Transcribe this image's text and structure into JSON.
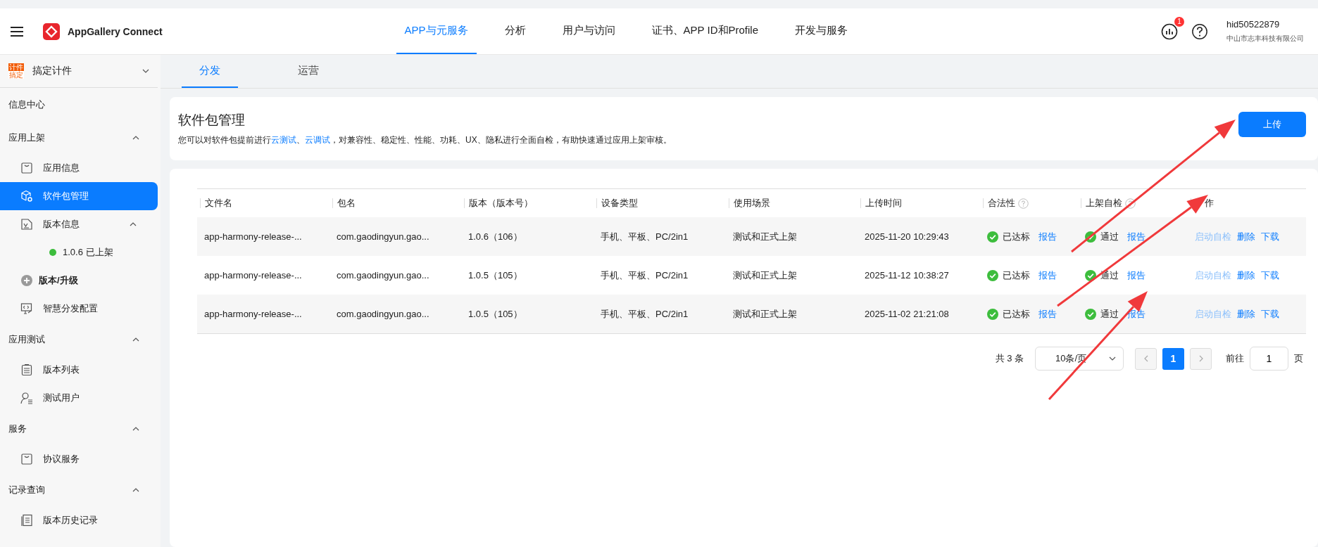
{
  "top_bar": {
    "logo_text": "AppGallery Connect",
    "nav": [
      {
        "label": "APP与元服务",
        "selected": true
      },
      {
        "label": "分析",
        "selected": false
      },
      {
        "label": "用户与访问",
        "selected": false
      },
      {
        "label": "证书、APP ID和Profile",
        "selected": false
      },
      {
        "label": "开发与服务",
        "selected": false
      }
    ],
    "notification_badge": "1",
    "user": {
      "name": "hid50522879",
      "company": "中山市志丰科技有限公司"
    }
  },
  "sidebar": {
    "app": {
      "name": "搞定计件",
      "logo_lines": [
        "计件",
        "搞定"
      ]
    },
    "groups": [
      {
        "label": "信息中心",
        "kind": "link"
      },
      {
        "label": "应用上架",
        "kind": "section",
        "expanded": true,
        "items": [
          {
            "label": "应用信息",
            "kind": "box",
            "selected": false
          },
          {
            "label": "软件包管理",
            "kind": "package",
            "selected": true
          },
          {
            "label": "版本信息",
            "kind": "version",
            "selected": false,
            "expanded": true,
            "children": [
              {
                "label": "1.0.6 已上架",
                "color": "#3dbd3d",
                "selected": false
              }
            ]
          },
          {
            "label": "版本/升级",
            "kind": "plus",
            "selected": false
          },
          {
            "label": "智慧分发配置",
            "kind": "smart",
            "selected": false
          }
        ]
      },
      {
        "label": "应用测试",
        "kind": "section",
        "expanded": true,
        "items": [
          {
            "label": "版本列表",
            "kind": "list",
            "selected": false
          },
          {
            "label": "测试用户",
            "kind": "user",
            "selected": false
          }
        ]
      },
      {
        "label": "服务",
        "kind": "section",
        "expanded": true,
        "items": [
          {
            "label": "协议服务",
            "kind": "box",
            "selected": false
          }
        ]
      },
      {
        "label": "记录查询",
        "kind": "section",
        "expanded": true,
        "items": [
          {
            "label": "版本历史记录",
            "kind": "doc",
            "selected": false
          }
        ]
      }
    ]
  },
  "sub_tabs": [
    {
      "label": "分发",
      "selected": true
    },
    {
      "label": "运营",
      "selected": false
    }
  ],
  "header": {
    "title": "软件包管理",
    "description": [
      {
        "text": "您可以对软件包提前进行"
      },
      {
        "text": "云测试",
        "link": true
      },
      {
        "text": "、"
      },
      {
        "text": "云调试",
        "link": true
      },
      {
        "text": "，对兼容性、稳定性、性能、功耗、UX、隐私进行全面自检，有助快速通过应用上架审核。"
      }
    ],
    "upload_button": "上传"
  },
  "table": {
    "columns": [
      {
        "label": "文件名",
        "help": false
      },
      {
        "label": "包名",
        "help": false
      },
      {
        "label": "版本（版本号）",
        "help": false
      },
      {
        "label": "设备类型",
        "help": false
      },
      {
        "label": "使用场景",
        "help": false
      },
      {
        "label": "上传时间",
        "help": false
      },
      {
        "label": "合法性",
        "help": true
      },
      {
        "label": "上架自检",
        "help": true
      },
      {
        "label": "作",
        "help": false
      }
    ],
    "rows": [
      {
        "file": "app-harmony-release-...",
        "package": "com.gaodingyun.gao...",
        "version": "1.0.6（106）",
        "devices": "手机、平板、PC/2in1",
        "scenario": "测试和正式上架",
        "time": "2025-11-20 10:29:43",
        "compliance": {
          "text": "已达标",
          "report": "报告"
        },
        "self_check": {
          "text": "通过",
          "report": "报告"
        },
        "actions": [
          {
            "label": "启动自检",
            "disabled": true
          },
          {
            "label": "删除",
            "disabled": false
          },
          {
            "label": "下载",
            "disabled": false
          }
        ]
      },
      {
        "file": "app-harmony-release-...",
        "package": "com.gaodingyun.gao...",
        "version": "1.0.5（105）",
        "devices": "手机、平板、PC/2in1",
        "scenario": "测试和正式上架",
        "time": "2025-11-12 10:38:27",
        "compliance": {
          "text": "已达标",
          "report": "报告"
        },
        "self_check": {
          "text": "通过",
          "report": "报告"
        },
        "actions": [
          {
            "label": "启动自检",
            "disabled": true
          },
          {
            "label": "删除",
            "disabled": false
          },
          {
            "label": "下载",
            "disabled": false
          }
        ]
      },
      {
        "file": "app-harmony-release-...",
        "package": "com.gaodingyun.gao...",
        "version": "1.0.5（105）",
        "devices": "手机、平板、PC/2in1",
        "scenario": "测试和正式上架",
        "time": "2025-11-02 21:21:08",
        "compliance": {
          "text": "已达标",
          "report": "报告"
        },
        "self_check": {
          "text": "通过",
          "report": "报告"
        },
        "actions": [
          {
            "label": "启动自检",
            "disabled": true
          },
          {
            "label": "删除",
            "disabled": false
          },
          {
            "label": "下载",
            "disabled": false
          }
        ]
      }
    ]
  },
  "pagination": {
    "total": "共 3 条",
    "page_size": "10条/页",
    "pages": [
      {
        "label": "1",
        "selected": true
      }
    ],
    "goto_label": "前往",
    "goto_value": "1",
    "goto_suffix": "页"
  },
  "annotations": [
    {
      "kind": "arrow"
    },
    {
      "kind": "arrow"
    },
    {
      "kind": "arrow"
    }
  ]
}
